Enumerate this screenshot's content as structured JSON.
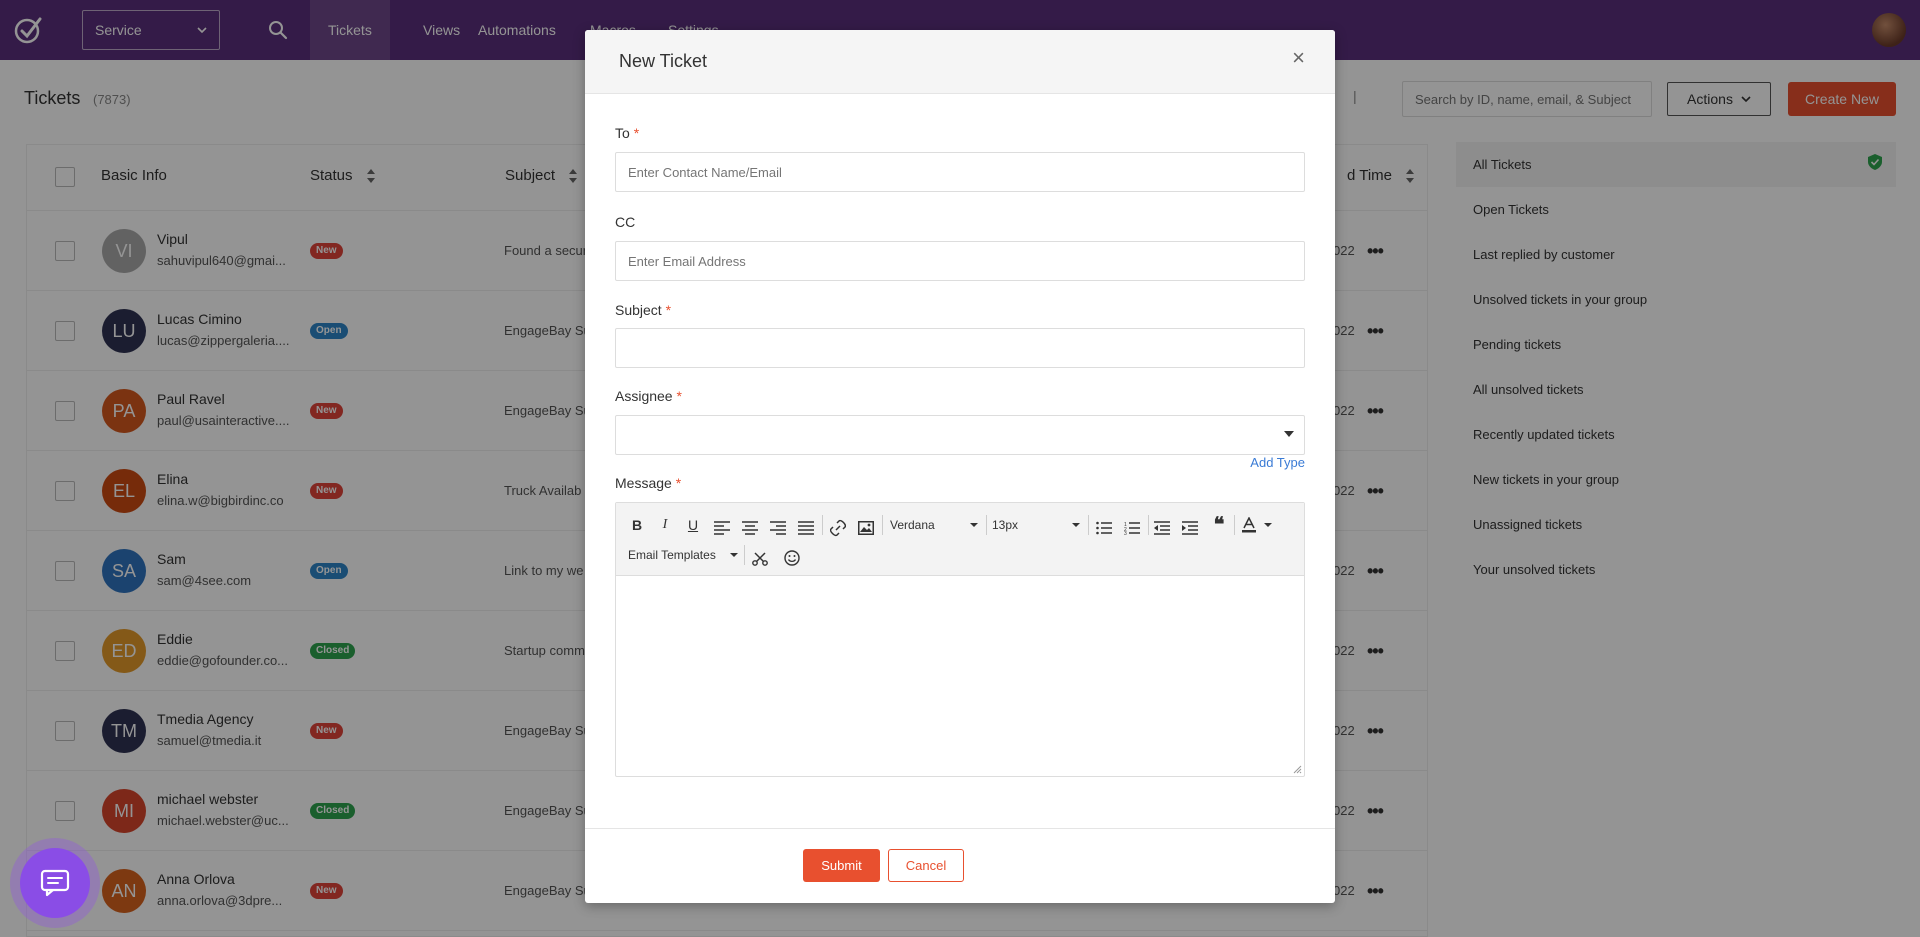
{
  "nav": {
    "service_label": "Service",
    "items": [
      {
        "label": "Tickets"
      },
      {
        "label": "Views"
      },
      {
        "label": "Automations"
      },
      {
        "label": "Macros"
      },
      {
        "label": "Settings"
      },
      {
        "label": "···"
      }
    ]
  },
  "page": {
    "title": "Tickets",
    "count": "(7873)",
    "separator": "|",
    "search_placeholder": "Search by ID, name, email, & Subject",
    "actions_label": "Actions",
    "create_label": "Create New"
  },
  "table": {
    "headers": {
      "basic_info": "Basic Info",
      "status": "Status",
      "subject": "Subject",
      "time": "d Time"
    },
    "rows": [
      {
        "initials": "VI",
        "name": "Vipul",
        "email": "sahuvipul640@gmai...",
        "status": "New",
        "subject": "Found a secur",
        "time": "022",
        "avatar_color": "#a9a9a9",
        "badge_color": "#e0443a"
      },
      {
        "initials": "LU",
        "name": "Lucas Cimino",
        "email": "lucas@zippergaleria....",
        "status": "Open",
        "subject": "EngageBay Su",
        "time": "022",
        "avatar_color": "#2f3354",
        "badge_color": "#2d86c9"
      },
      {
        "initials": "PA",
        "name": "Paul Ravel",
        "email": "paul@usainteractive....",
        "status": "New",
        "subject": "EngageBay Su",
        "time": "022",
        "avatar_color": "#d5591e",
        "badge_color": "#e0443a"
      },
      {
        "initials": "EL",
        "name": "Elina",
        "email": "elina.w@bigbirdinc.co",
        "status": "New",
        "subject": "Truck Availab",
        "time": "022",
        "avatar_color": "#cc4a12",
        "badge_color": "#e0443a"
      },
      {
        "initials": "SA",
        "name": "Sam",
        "email": "sam@4see.com",
        "status": "Open",
        "subject": "Link to my we",
        "time": "022",
        "avatar_color": "#2f74bf",
        "badge_color": "#2d86c9"
      },
      {
        "initials": "ED",
        "name": "Eddie",
        "email": "eddie@gofounder.co...",
        "status": "Closed",
        "subject": "Startup comm",
        "time": "022",
        "avatar_color": "#e49a2a",
        "badge_color": "#2ea44f"
      },
      {
        "initials": "TM",
        "name": "Tmedia Agency",
        "email": "samuel@tmedia.it",
        "status": "New",
        "subject": "EngageBay Su",
        "time": "022",
        "avatar_color": "#2f3354",
        "badge_color": "#e0443a"
      },
      {
        "initials": "MI",
        "name": "michael webster",
        "email": "michael.webster@uc...",
        "status": "Closed",
        "subject": "EngageBay Su",
        "time": "022",
        "avatar_color": "#d8452c",
        "badge_color": "#2ea44f"
      },
      {
        "initials": "AN",
        "name": "Anna Orlova",
        "email": "anna.orlova@3dpre...",
        "status": "New",
        "subject": "EngageBay Su",
        "time": "022",
        "avatar_color": "#d8621e",
        "badge_color": "#e0443a"
      }
    ]
  },
  "sidebar": {
    "items": [
      {
        "label": "All Tickets"
      },
      {
        "label": "Open Tickets"
      },
      {
        "label": "Last replied by customer"
      },
      {
        "label": "Unsolved tickets in your group"
      },
      {
        "label": "Pending tickets"
      },
      {
        "label": "All unsolved tickets"
      },
      {
        "label": "Recently updated tickets"
      },
      {
        "label": "New tickets in your group"
      },
      {
        "label": "Unassigned tickets"
      },
      {
        "label": "Your unsolved tickets"
      }
    ]
  },
  "modal": {
    "title": "New Ticket",
    "close": "×",
    "to_label": "To",
    "to_placeholder": "Enter Contact Name/Email",
    "cc_label": "CC",
    "cc_placeholder": "Enter Email Address",
    "subject_label": "Subject",
    "assignee_label": "Assignee",
    "add_type": "Add Type",
    "message_label": "Message",
    "required_mark": "*",
    "font_family": "Verdana",
    "font_size": "13px",
    "email_templates": "Email Templates",
    "submit_label": "Submit",
    "cancel_label": "Cancel"
  },
  "colors": {
    "nav_bg": "#5a2f7c",
    "accent": "#e8502f",
    "link": "#3a7bd5",
    "chat": "#8a4de6"
  }
}
